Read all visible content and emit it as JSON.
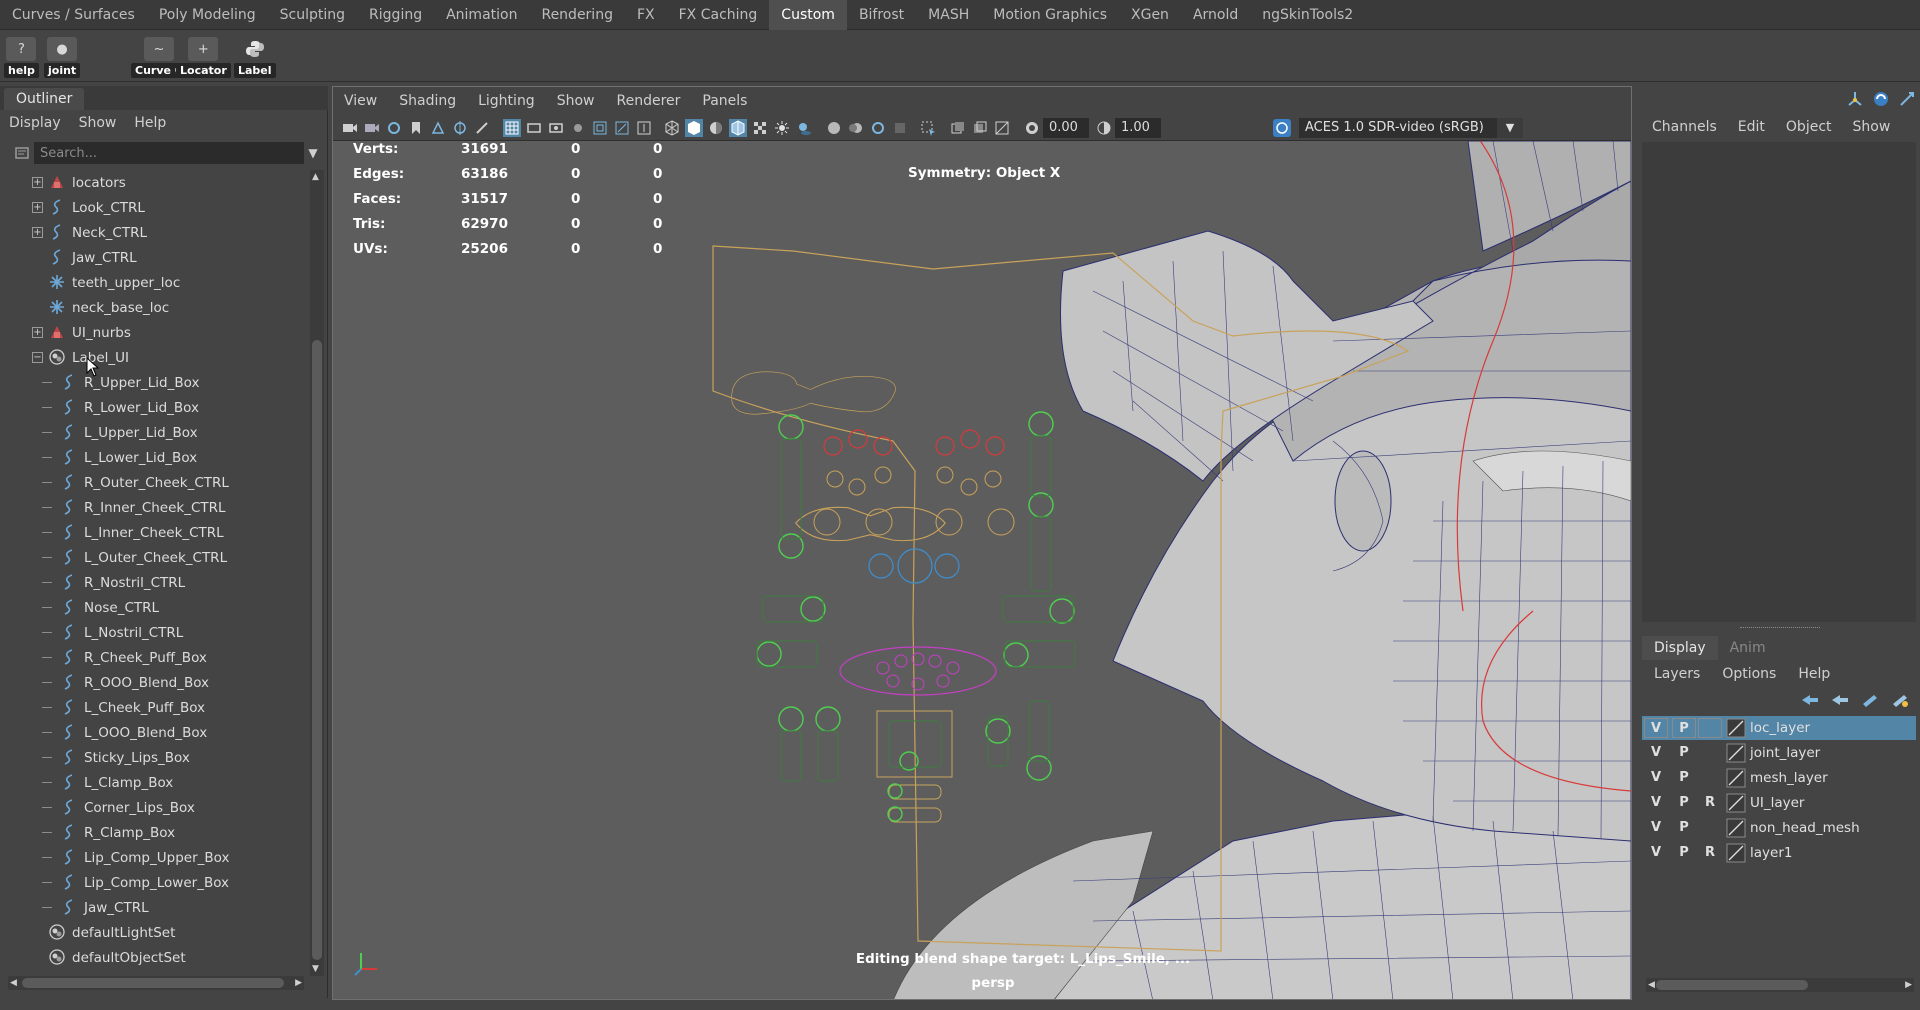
{
  "shelf_tabs": [
    "Curves / Surfaces",
    "Poly Modeling",
    "Sculpting",
    "Rigging",
    "Animation",
    "Rendering",
    "FX",
    "FX Caching",
    "Custom",
    "Bifrost",
    "MASH",
    "Motion Graphics",
    "XGen",
    "Arnold",
    "ngSkinTools2"
  ],
  "shelf_active_tab": "Custom",
  "shelf_buttons": [
    "help",
    "joint",
    "Curve C",
    "Locator",
    "Label"
  ],
  "outliner": {
    "title": "Outliner",
    "menu": [
      "Display",
      "Show",
      "Help"
    ],
    "search_placeholder": "Search...",
    "items": [
      {
        "label": "locators",
        "icon": "set-icon"
      },
      {
        "label": "Look_CTRL",
        "icon": "curve-icon"
      },
      {
        "label": "Neck_CTRL",
        "icon": "curve-icon"
      },
      {
        "label": "Jaw_CTRL",
        "icon": "curve-icon"
      },
      {
        "label": "teeth_upper_loc",
        "icon": "locator-icon"
      },
      {
        "label": "neck_base_loc",
        "icon": "locator-icon"
      },
      {
        "label": "UI_nurbs",
        "icon": "set-icon"
      },
      {
        "label": "Label_UI",
        "icon": "object-set-icon"
      },
      {
        "label": "R_Upper_Lid_Box",
        "icon": "curve-icon"
      },
      {
        "label": "R_Lower_Lid_Box",
        "icon": "curve-icon"
      },
      {
        "label": "L_Upper_Lid_Box",
        "icon": "curve-icon"
      },
      {
        "label": "L_Lower_Lid_Box",
        "icon": "curve-icon"
      },
      {
        "label": "R_Outer_Cheek_CTRL",
        "icon": "curve-icon"
      },
      {
        "label": "R_Inner_Cheek_CTRL",
        "icon": "curve-icon"
      },
      {
        "label": "L_Inner_Cheek_CTRL",
        "icon": "curve-icon"
      },
      {
        "label": "L_Outer_Cheek_CTRL",
        "icon": "curve-icon"
      },
      {
        "label": "R_Nostril_CTRL",
        "icon": "curve-icon"
      },
      {
        "label": "Nose_CTRL",
        "icon": "curve-icon"
      },
      {
        "label": "L_Nostril_CTRL",
        "icon": "curve-icon"
      },
      {
        "label": "R_Cheek_Puff_Box",
        "icon": "curve-icon"
      },
      {
        "label": "R_OOO_Blend_Box",
        "icon": "curve-icon"
      },
      {
        "label": "L_Cheek_Puff_Box",
        "icon": "curve-icon"
      },
      {
        "label": "L_OOO_Blend_Box",
        "icon": "curve-icon"
      },
      {
        "label": "Sticky_Lips_Box",
        "icon": "curve-icon"
      },
      {
        "label": "L_Clamp_Box",
        "icon": "curve-icon"
      },
      {
        "label": "Corner_Lips_Box",
        "icon": "curve-icon"
      },
      {
        "label": "R_Clamp_Box",
        "icon": "curve-icon"
      },
      {
        "label": "Lip_Comp_Upper_Box",
        "icon": "curve-icon"
      },
      {
        "label": "Lip_Comp_Lower_Box",
        "icon": "curve-icon"
      },
      {
        "label": "Jaw_CTRL",
        "icon": "curve-icon"
      },
      {
        "label": "defaultLightSet",
        "icon": "object-set-icon"
      },
      {
        "label": "defaultObjectSet",
        "icon": "object-set-icon"
      }
    ]
  },
  "viewport": {
    "menu": [
      "View",
      "Shading",
      "Lighting",
      "Show",
      "Renderer",
      "Panels"
    ],
    "exposure": "0.00",
    "gamma": "1.00",
    "colorspace": "ACES 1.0 SDR-video (sRGB)",
    "hud": [
      {
        "label": "Verts:",
        "a": "31691",
        "b": "0",
        "c": "0"
      },
      {
        "label": "Edges:",
        "a": "63186",
        "b": "0",
        "c": "0"
      },
      {
        "label": "Faces:",
        "a": "31517",
        "b": "0",
        "c": "0"
      },
      {
        "label": "Tris:",
        "a": "62970",
        "b": "0",
        "c": "0"
      },
      {
        "label": "UVs:",
        "a": "25206",
        "b": "0",
        "c": "0"
      }
    ],
    "symmetry": "Symmetry: Object X",
    "status": "Editing blend shape target: L_Lips_Smile, ...",
    "camera": "persp"
  },
  "channel_box": {
    "menu": [
      "Channels",
      "Edit",
      "Object",
      "Show"
    ],
    "layer_tabs": [
      "Display",
      "Anim"
    ],
    "layer_active_tab": "Display",
    "layer_menu": [
      "Layers",
      "Options",
      "Help"
    ],
    "layers": [
      {
        "v": "V",
        "p": "P",
        "r": "",
        "name": "loc_layer",
        "selected": true
      },
      {
        "v": "V",
        "p": "P",
        "r": "",
        "name": "joint_layer",
        "selected": false
      },
      {
        "v": "V",
        "p": "P",
        "r": "",
        "name": "mesh_layer",
        "selected": false
      },
      {
        "v": "V",
        "p": "P",
        "r": "R",
        "name": "UI_layer",
        "selected": false
      },
      {
        "v": "V",
        "p": "P",
        "r": "",
        "name": "non_head_mesh",
        "selected": false
      },
      {
        "v": "V",
        "p": "P",
        "r": "R",
        "name": "layer1",
        "selected": false
      }
    ]
  },
  "colors": {
    "selection": "#5285a6",
    "ui_curve": "#c9a25a",
    "ctrl_green": "#4fcf4f",
    "ctrl_red": "#d83a3a",
    "ctrl_blue": "#3f8fd0",
    "ctrl_magenta": "#c63fc6"
  }
}
